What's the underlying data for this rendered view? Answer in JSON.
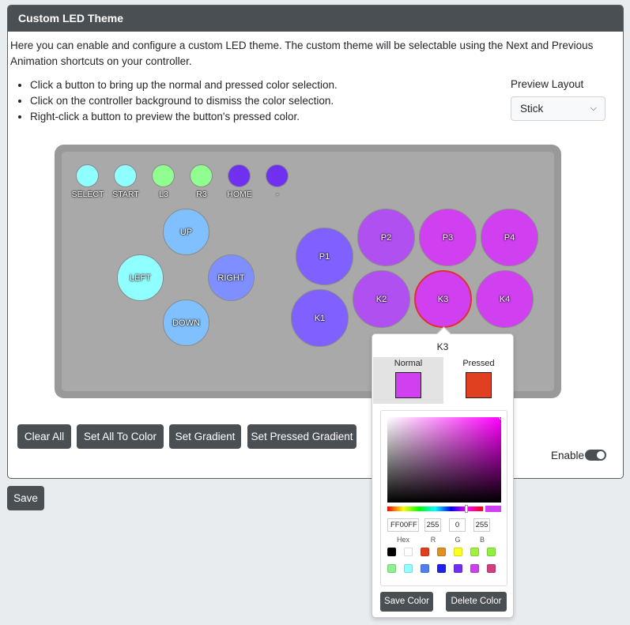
{
  "card": {
    "title": "Custom LED Theme",
    "intro": "Here you can enable and configure a custom LED theme. The custom theme will be selectable using the Next and Previous Animation shortcuts on your controller.",
    "bullets": [
      "Click a button to bring up the normal and pressed color selection.",
      "Click on the controller background to dismiss the color selection.",
      "Right-click a button to preview the button's pressed color."
    ],
    "preview_label": "Preview Layout",
    "preview_value": "Stick"
  },
  "controller": {
    "small_buttons": [
      {
        "label": "SELECT",
        "color": "#90ffff"
      },
      {
        "label": "START",
        "color": "#90ffff"
      },
      {
        "label": "L3",
        "color": "#90ff90"
      },
      {
        "label": "R3",
        "color": "#90ff90"
      },
      {
        "label": "HOME",
        "color": "#7030f0"
      },
      {
        "label": "-",
        "color": "#7030f0"
      }
    ],
    "dpad": {
      "up": {
        "label": "UP",
        "color": "#80c0ff"
      },
      "left": {
        "label": "LEFT",
        "color": "#90ffff"
      },
      "right": {
        "label": "RIGHT",
        "color": "#7f8fff"
      },
      "down": {
        "label": "DOWN",
        "color": "#80c0ff"
      }
    },
    "face": [
      {
        "label": "P1",
        "color": "#8060ff"
      },
      {
        "label": "P2",
        "color": "#b050f0"
      },
      {
        "label": "P3",
        "color": "#d040f0"
      },
      {
        "label": "P4",
        "color": "#d040f0"
      },
      {
        "label": "K1",
        "color": "#8060ff"
      },
      {
        "label": "K2",
        "color": "#b050f0"
      },
      {
        "label": "K3",
        "color": "#d040f0"
      },
      {
        "label": "K4",
        "color": "#d040f0"
      }
    ],
    "selected": "K3",
    "selected_border_color": "#e03030"
  },
  "actions": {
    "clear_all": "Clear All",
    "set_all": "Set All To Color",
    "set_gradient": "Set Gradient",
    "set_pressed_gradient": "Set Pressed Gradient",
    "enable_label": "Enable",
    "save": "Save"
  },
  "popover": {
    "title": "K3",
    "normal_label": "Normal",
    "pressed_label": "Pressed",
    "normal_color": "#d040f0",
    "pressed_color": "#e04020",
    "hex_value": "FF00FF",
    "r_value": "255",
    "g_value": "0",
    "b_value": "255",
    "hex_label": "Hex",
    "r_label": "R",
    "g_label": "G",
    "b_label": "B",
    "presets": [
      "#000000",
      "#ffffff",
      "#e04020",
      "#e09020",
      "#ffff20",
      "#a0f040",
      "#90f040",
      "#90f090",
      "#90ffff",
      "#5080f0",
      "#2020f0",
      "#7030f0",
      "#d040f0",
      "#d04080"
    ],
    "save_color": "Save Color",
    "delete_color": "Delete Color"
  }
}
